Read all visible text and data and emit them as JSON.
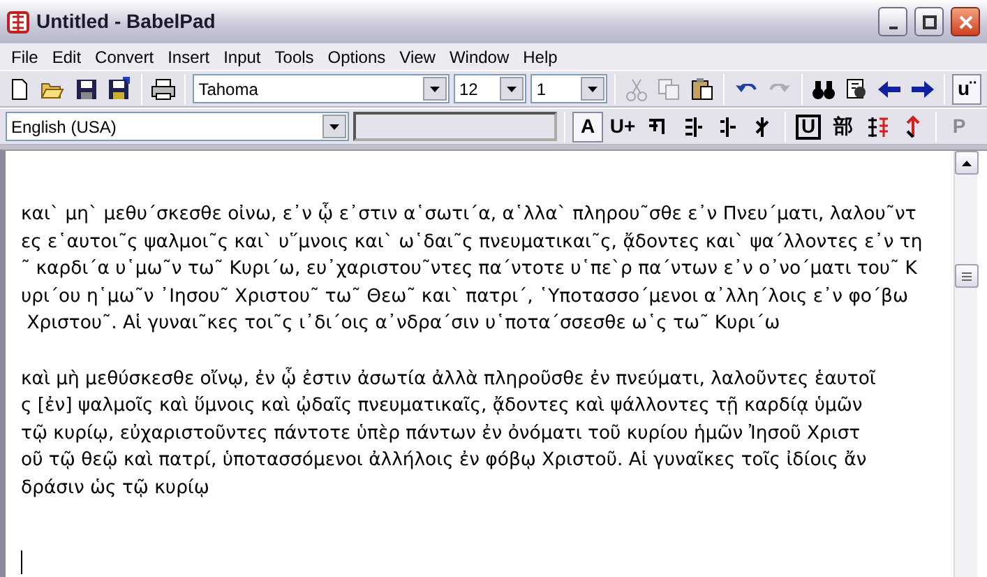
{
  "window": {
    "title": "Untitled - BabelPad"
  },
  "menu": [
    "File",
    "Edit",
    "Convert",
    "Insert",
    "Input",
    "Tools",
    "Options",
    "View",
    "Window",
    "Help"
  ],
  "toolbar": [
    {
      "kind": "new",
      "disabled": false,
      "pressed": false
    },
    {
      "kind": "open",
      "disabled": false,
      "pressed": false
    },
    {
      "kind": "save",
      "disabled": false,
      "pressed": false
    },
    {
      "kind": "save-as",
      "disabled": false,
      "pressed": false
    },
    {
      "kind": "sep"
    },
    {
      "kind": "print",
      "disabled": false,
      "pressed": false
    },
    {
      "kind": "sep"
    },
    {
      "kind": "font",
      "value": "Tahoma"
    },
    {
      "kind": "size",
      "value": "12"
    },
    {
      "kind": "spacing",
      "value": "1"
    },
    {
      "kind": "sep"
    },
    {
      "kind": "cut",
      "disabled": true,
      "pressed": false
    },
    {
      "kind": "copy",
      "disabled": true,
      "pressed": false
    },
    {
      "kind": "paste",
      "disabled": false,
      "pressed": false
    },
    {
      "kind": "sep"
    },
    {
      "kind": "undo",
      "disabled": false,
      "pressed": false
    },
    {
      "kind": "redo",
      "disabled": true,
      "pressed": false
    },
    {
      "kind": "sep"
    },
    {
      "kind": "find",
      "disabled": false,
      "pressed": false
    },
    {
      "kind": "replace",
      "disabled": false,
      "pressed": false
    },
    {
      "kind": "back",
      "disabled": false,
      "pressed": false
    },
    {
      "kind": "forward",
      "disabled": false,
      "pressed": false
    },
    {
      "kind": "sep"
    },
    {
      "kind": "label",
      "label": "u¨",
      "disabled": false,
      "pressed": true
    }
  ],
  "toolbar_2": [
    {
      "kind": "language",
      "value": "English (USA)"
    },
    {
      "kind": "blank"
    },
    {
      "kind": "sep"
    },
    {
      "kind": "label",
      "label": "A",
      "disabled": false,
      "pressed": true
    },
    {
      "kind": "label",
      "label": "U+",
      "disabled": false,
      "pressed": false
    },
    {
      "kind": "glyph-a",
      "disabled": false,
      "pressed": false
    },
    {
      "kind": "glyph-b",
      "disabled": false,
      "pressed": false
    },
    {
      "kind": "glyph-c",
      "disabled": false,
      "pressed": false
    },
    {
      "kind": "glyph-d",
      "disabled": false,
      "pressed": false
    },
    {
      "kind": "sep"
    },
    {
      "kind": "boxed",
      "label": "U",
      "disabled": false,
      "pressed": false
    },
    {
      "kind": "label",
      "label": "部",
      "disabled": false,
      "pressed": false
    },
    {
      "kind": "glyph-e",
      "disabled": false,
      "pressed": false
    },
    {
      "kind": "glyph-f",
      "disabled": false,
      "pressed": false
    },
    {
      "kind": "sep"
    },
    {
      "kind": "label",
      "label": "P",
      "disabled": true,
      "pressed": false
    }
  ],
  "document": {
    "paragraphs": [
      {
        "lines": [
          "και` μη` μεθυ´σκεσθε οἰνω, ε᾿ν ᾧ ε᾿στιν α῾σωτι´α, α῾λλα` πληρου˜σθε ε᾿ν Πνευ´ματι, λαλου˜ντ",
          "ες ε῾αυτοι˜ς ψαλμοι˜ς και` υ῞μνοις και` ω῾δαι˜ς πνευματικαι˜ς, ᾄδοντες και` ψα´λλοντες ε᾿ν τη",
          "˜ καρδι´α υ῾μω˜ν τω˜ Κυρι´ω, ευ᾿χαριστου˜ντες πα´ντοτε υ῾πε`ρ πα´ντων ε᾿ν ο᾿νο´ματι του˜ Κ",
          "υρι´ου η῾μω˜ν ᾿Ιησου˜ Χριστου˜ τω˜ Θεω˜ και` πατρι´, ῾Υποτασσο´μενοι α᾿λλη´λοις ε᾿ν φο´βω",
          " Χριστου˜. Αἱ γυναι˜κες τοι˜ς ι᾿δι´οις α᾿νδρα´σιν υ῾ποτα´σσεσθε ω῾ς τω˜ Κυρι´ω"
        ]
      },
      {
        "lines": [
          "καὶ μὴ μεθύσκεσθε οἴνῳ, ἐν ᾧ ἐστιν ἀσωτία ἀλλὰ πληροῦσθε ἐν πνεύματι, λαλοῦντες ἑαυτοῖ",
          "ς [ἐν] ψαλμοῖς καὶ ὕμνοις καὶ ᾠδαῖς πνευματικαῖς, ᾄδοντες καὶ ψάλλοντες τῇ καρδίᾳ ὑμῶν",
          "τῷ κυρίῳ, εὐχαριστοῦντες πάντοτε ὑπὲρ πάντων ἐν ὀνόματι τοῦ κυρίου ἡμῶν Ἰησοῦ Χριστ",
          "οῦ τῷ θεῷ καὶ πατρί, ὑποτασσόμενοι ἀλλήλοις ἐν φόβῳ Χριστοῦ. Αἱ γυναῖκες τοῖς ἰδίοις ἄν",
          "δράσιν ὡς τῷ κυρίῳ"
        ]
      }
    ]
  }
}
